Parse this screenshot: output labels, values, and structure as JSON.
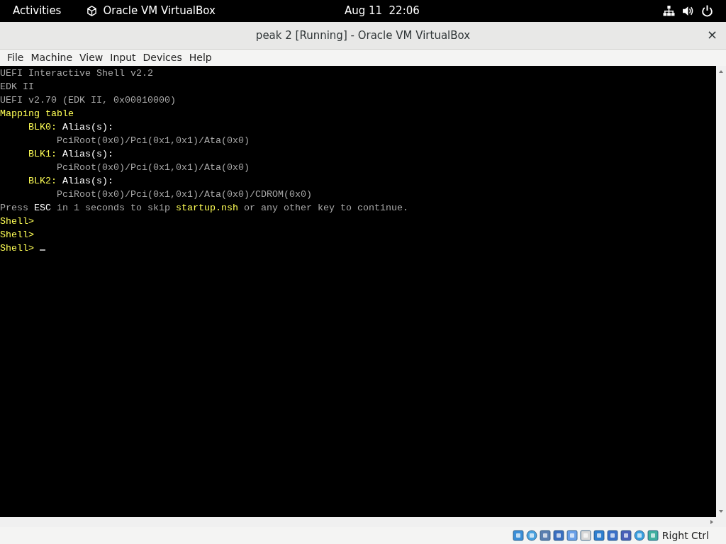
{
  "top_bar": {
    "activities": "Activities",
    "app_name": "Oracle VM VirtualBox",
    "clock": "Aug 11  22:06"
  },
  "window": {
    "title": "peak 2 [Running] - Oracle VM VirtualBox",
    "close": "×"
  },
  "menu": [
    "File",
    "Machine",
    "View",
    "Input",
    "Devices",
    "Help"
  ],
  "console": {
    "lines": [
      [
        {
          "kind": "plain",
          "text": "UEFI Interactive Shell v2.2"
        }
      ],
      [
        {
          "kind": "plain",
          "text": "EDK II"
        }
      ],
      [
        {
          "kind": "plain",
          "text": "UEFI v2.70 (EDK II, 0x00010000)"
        }
      ],
      [
        {
          "kind": "yellow",
          "text": "Mapping table"
        }
      ],
      [
        {
          "kind": "yellow",
          "text": "     BLK0:"
        },
        {
          "kind": "bright",
          "text": " Alias(s):"
        }
      ],
      [
        {
          "kind": "plain",
          "text": "          PciRoot(0x0)/Pci(0x1,0x1)/Ata(0x0)"
        }
      ],
      [
        {
          "kind": "yellow",
          "text": "     BLK1:"
        },
        {
          "kind": "bright",
          "text": " Alias(s):"
        }
      ],
      [
        {
          "kind": "plain",
          "text": "          PciRoot(0x0)/Pci(0x1,0x1)/Ata(0x0)"
        }
      ],
      [
        {
          "kind": "yellow",
          "text": "     BLK2:"
        },
        {
          "kind": "bright",
          "text": " Alias(s):"
        }
      ],
      [
        {
          "kind": "plain",
          "text": "          PciRoot(0x0)/Pci(0x1,0x1)/Ata(0x0)/CDROM(0x0)"
        }
      ],
      [
        {
          "kind": "plain",
          "text": "Press "
        },
        {
          "kind": "bright",
          "text": "ESC"
        },
        {
          "kind": "plain",
          "text": " in 1 seconds to skip "
        },
        {
          "kind": "yellow",
          "text": "startup.nsh"
        },
        {
          "kind": "plain",
          "text": " or any other key to continue."
        }
      ],
      [
        {
          "kind": "yellow",
          "text": "Shell>"
        }
      ],
      [
        {
          "kind": "yellow",
          "text": "Shell>"
        }
      ],
      [
        {
          "kind": "yellow",
          "text": "Shell>"
        }
      ]
    ],
    "cursor": true
  },
  "status_bar": {
    "host_key": "Right Ctrl"
  }
}
